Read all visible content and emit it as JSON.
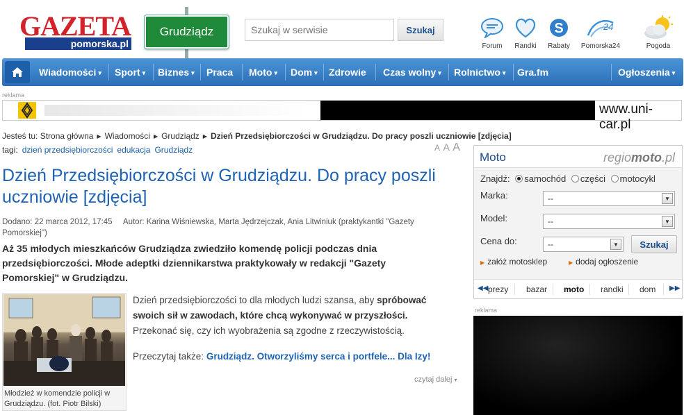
{
  "header": {
    "logo_top": "GAZETA",
    "logo_bottom": "pomorska.pl",
    "city": "Grudziądz",
    "search": {
      "placeholder": "Szukaj w serwisie",
      "button": "Szukaj"
    },
    "icons": [
      {
        "label": "Forum",
        "icon": "chat-bubble-icon"
      },
      {
        "label": "Randki",
        "icon": "heart-icon"
      },
      {
        "label": "Rabaty",
        "icon": "discount-s-icon"
      },
      {
        "label": "Pomorska24",
        "icon": "pomorska24-icon"
      },
      {
        "label": "Pogoda",
        "icon": "weather-sun-cloud-icon"
      }
    ]
  },
  "nav": {
    "items": [
      {
        "label": "Wiadomości",
        "dropdown": true
      },
      {
        "label": "Sport",
        "dropdown": true
      },
      {
        "label": "Biznes",
        "dropdown": true
      },
      {
        "label": "Praca",
        "dropdown": false
      },
      {
        "label": "Moto",
        "dropdown": true
      },
      {
        "label": "Dom",
        "dropdown": true
      },
      {
        "label": "Zdrowie",
        "dropdown": false
      },
      {
        "label": "Czas wolny",
        "dropdown": true
      },
      {
        "label": "Rolnictwo",
        "dropdown": true
      },
      {
        "label": "Gra.fm",
        "dropdown": false
      }
    ],
    "right": "Ogłoszenia",
    "arrow": "▾"
  },
  "ad": {
    "label": "reklama",
    "url": "www.uni-car.pl",
    "brand": "RENAULT"
  },
  "breadcrumb": {
    "prefix": "Jesteś tu:",
    "items": [
      "Strona główna",
      "Wiadomości",
      "Grudziądz"
    ],
    "current": "Dzień Przedsiębiorczości w Grudziądzu. Do pracy poszli uczniowie [zdjęcia]",
    "separator": "▶"
  },
  "tags": {
    "prefix": "tagi:",
    "items": [
      "dzień przedsiębiorczości",
      "edukacja",
      "Grudziądz"
    ]
  },
  "font_size": [
    "A",
    "A",
    "A"
  ],
  "article": {
    "title": "Dzień Przedsiębiorczości w Grudziądzu. Do pracy poszli uczniowie [zdjęcia]",
    "date": "Dodano: 22 marca 2012, 17:45",
    "authors": "Autor: Karina Wiśniewska, Marta Jędrzejczak, Ania Litwiniuk (praktykantki \"Gazety Pomorskiej\")",
    "lead": "Aż 35 młodych mieszkańców Grudziądza zwiedziło komendę policji podczas dnia przedsiębiorczości. Młode adeptki dziennikarstwa praktykowały w redakcji \"Gazety Pomorskiej\" w Grudziądzu.",
    "photo_caption": "Młodzież w komendzie policji w Grudziądzu. (fot. Piotr Bilski)",
    "body_pre": "Dzień przedsiębiorczości to dla młodych ludzi szansa, aby ",
    "body_bold": "spróbować swoich sił w zawodach, które chcą wykonywać w przyszłości.",
    "body_post": " Przekonać się, czy ich wyobrażenia są zgodne z rzeczywistością.",
    "read_also_prefix": "Przeczytaj także:",
    "read_also_link": "Grudziądz. Otworzyliśmy serca i portfele... Dla Izy!",
    "more": "czytaj dalej"
  },
  "moto": {
    "title": "Moto",
    "brand_pre": "regio",
    "brand_bold": "moto",
    "brand_post": ".pl",
    "find_label": "Znajdź:",
    "options": [
      {
        "label": "samochód",
        "selected": true
      },
      {
        "label": "części",
        "selected": false
      },
      {
        "label": "motocykl",
        "selected": false
      }
    ],
    "fields": [
      {
        "label": "Marka:",
        "value": "--"
      },
      {
        "label": "Model:",
        "value": "--"
      },
      {
        "label": "Cena do:",
        "value": "--"
      }
    ],
    "button": "Szukaj",
    "links": [
      "załóż motosklep",
      "dodaj ogłoszenie"
    ],
    "tabs": [
      "prezy",
      "bazar",
      "moto",
      "randki",
      "dom"
    ],
    "active_tab": "moto"
  },
  "side_ad": {
    "label": "reklama"
  }
}
